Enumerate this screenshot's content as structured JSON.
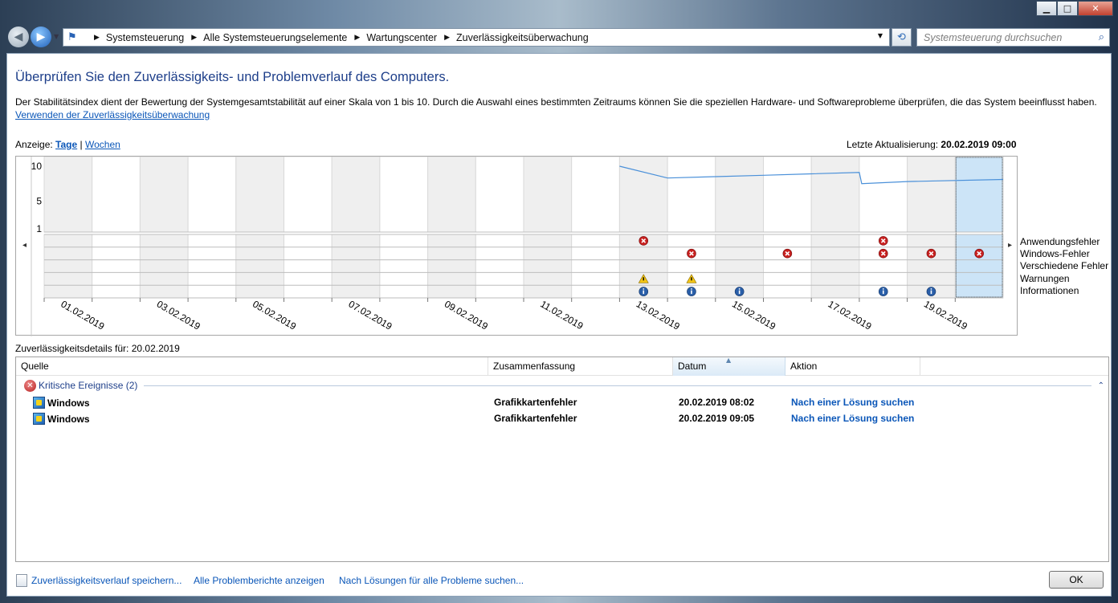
{
  "window": {
    "minimize_label": "▁",
    "maximize_label": "□",
    "close_label": "✕"
  },
  "address": {
    "crumbs": [
      "Systemsteuerung",
      "Alle Systemsteuerungselemente",
      "Wartungscenter",
      "Zuverlässigkeitsüberwachung"
    ],
    "search_placeholder": "Systemsteuerung durchsuchen"
  },
  "page": {
    "heading": "Überprüfen Sie den Zuverlässigkeits- und Problemverlauf des Computers.",
    "description": "Der Stabilitätsindex dient der Bewertung der Systemgesamtstabilität auf einer Skala von 1 bis 10. Durch die Auswahl eines bestimmten Zeitraums können Sie die speziellen Hardware- und Softwareprobleme überprüfen, die das System beeinflusst haben.",
    "usage_link": "Verwenden der Zuverlässigkeitsüberwachung",
    "view_label": "Anzeige:",
    "view_days": "Tage",
    "view_separator": "|",
    "view_weeks": "Wochen",
    "last_update_label": "Letzte Aktualisierung:",
    "last_update_value": "20.02.2019 09:00"
  },
  "chart_data": {
    "type": "line",
    "title": "",
    "y_ticks": [
      "10",
      "5",
      "1"
    ],
    "ylim": [
      1,
      10
    ],
    "dates": [
      "01.02.2019",
      "02.02.2019",
      "03.02.2019",
      "04.02.2019",
      "05.02.2019",
      "06.02.2019",
      "07.02.2019",
      "08.02.2019",
      "09.02.2019",
      "10.02.2019",
      "11.02.2019",
      "12.02.2019",
      "13.02.2019",
      "14.02.2019",
      "15.02.2019",
      "16.02.2019",
      "17.02.2019",
      "18.02.2019",
      "19.02.2019",
      "20.02.2019"
    ],
    "x_tick_labels": [
      "01.02.2019",
      "03.02.2019",
      "05.02.2019",
      "07.02.2019",
      "09.02.2019",
      "11.02.2019",
      "13.02.2019",
      "15.02.2019",
      "17.02.2019",
      "19.02.2019"
    ],
    "selected_date": "20.02.2019",
    "stability_index": [
      {
        "date": "13.02.2019",
        "value": 10.0
      },
      {
        "date": "14.02.2019",
        "value": 8.3
      },
      {
        "date": "15.02.2019",
        "value": 8.5
      },
      {
        "date": "16.02.2019",
        "value": 8.7
      },
      {
        "date": "17.02.2019",
        "value": 8.9
      },
      {
        "date": "18.02.2019",
        "value": 9.1
      },
      {
        "date": "18.02.2019",
        "value": 7.5
      },
      {
        "date": "19.02.2019",
        "value": 7.8
      },
      {
        "date": "20.02.2019",
        "value": 8.1
      }
    ],
    "event_rows": [
      "Anwendungsfehler",
      "Windows-Fehler",
      "Verschiedene Fehler",
      "Warnungen",
      "Informationen"
    ],
    "events": [
      {
        "date": "13.02.2019",
        "row": "Anwendungsfehler",
        "kind": "error"
      },
      {
        "date": "18.02.2019",
        "row": "Anwendungsfehler",
        "kind": "error"
      },
      {
        "date": "14.02.2019",
        "row": "Windows-Fehler",
        "kind": "error"
      },
      {
        "date": "16.02.2019",
        "row": "Windows-Fehler",
        "kind": "error"
      },
      {
        "date": "18.02.2019",
        "row": "Windows-Fehler",
        "kind": "error"
      },
      {
        "date": "19.02.2019",
        "row": "Windows-Fehler",
        "kind": "error"
      },
      {
        "date": "20.02.2019",
        "row": "Windows-Fehler",
        "kind": "error"
      },
      {
        "date": "13.02.2019",
        "row": "Warnungen",
        "kind": "warning"
      },
      {
        "date": "14.02.2019",
        "row": "Warnungen",
        "kind": "warning"
      },
      {
        "date": "13.02.2019",
        "row": "Informationen",
        "kind": "info"
      },
      {
        "date": "14.02.2019",
        "row": "Informationen",
        "kind": "info"
      },
      {
        "date": "15.02.2019",
        "row": "Informationen",
        "kind": "info"
      },
      {
        "date": "18.02.2019",
        "row": "Informationen",
        "kind": "info"
      },
      {
        "date": "19.02.2019",
        "row": "Informationen",
        "kind": "info"
      }
    ],
    "colors": {
      "line": "#4a90d9",
      "selected": "#cce4f7",
      "shaded": "#efefef",
      "error": "#c8201f",
      "warning": "#f2c417",
      "info": "#2a5fa9"
    }
  },
  "details": {
    "title": "Zuverlässigkeitsdetails für: 20.02.2019",
    "columns": [
      "Quelle",
      "Zusammenfassung",
      "Datum",
      "Aktion"
    ],
    "group_label": "Kritische Ereignisse (2)",
    "group_toggle": "⌃",
    "rows": [
      {
        "source": "Windows",
        "summary": "Grafikkartenfehler",
        "date": "20.02.2019 08:02",
        "action": "Nach einer Lösung suchen"
      },
      {
        "source": "Windows",
        "summary": "Grafikkartenfehler",
        "date": "20.02.2019 09:05",
        "action": "Nach einer Lösung suchen"
      }
    ]
  },
  "footer": {
    "save_link": "Zuverlässigkeitsverlauf speichern...",
    "all_reports_link": "Alle Problemberichte anzeigen",
    "solutions_link": "Nach Lösungen für alle Probleme suchen...",
    "ok_label": "OK"
  }
}
